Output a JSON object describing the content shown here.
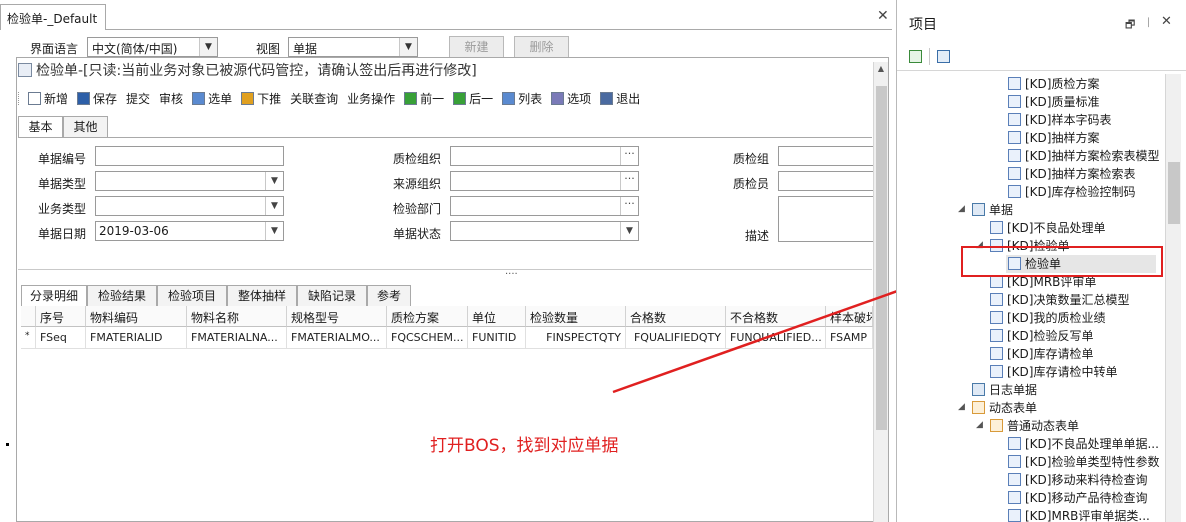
{
  "left_window": {
    "tab_title": "检验单-_Default",
    "top_row": {
      "ui_language_label": "界面语言",
      "ui_language_value": "中文(简体/中国)",
      "view_label": "视图",
      "view_value": "单据",
      "new_button": "新建",
      "delete_button": "删除"
    },
    "title": "检验单-[只读:当前业务对象已被源代码管控，请确认签出后再进行修改]",
    "toolbar": [
      {
        "label": "新增",
        "icon": "new-doc-icon"
      },
      {
        "label": "保存",
        "icon": "save-icon"
      },
      {
        "label": "提交",
        "icon": ""
      },
      {
        "label": "审核",
        "icon": ""
      },
      {
        "label": "选单",
        "icon": "select-bill-icon"
      },
      {
        "label": "下推",
        "icon": "push-down-icon"
      },
      {
        "label": "关联查询",
        "icon": ""
      },
      {
        "label": "业务操作",
        "icon": ""
      },
      {
        "label": "前一",
        "icon": "prev-arrow-icon"
      },
      {
        "label": "后一",
        "icon": "next-arrow-icon"
      },
      {
        "label": "列表",
        "icon": "list-icon"
      },
      {
        "label": "选项",
        "icon": "options-icon"
      },
      {
        "label": "退出",
        "icon": "exit-icon"
      }
    ],
    "header_tabs": [
      "基本",
      "其他"
    ],
    "form": {
      "bill_no_label": "单据编号",
      "bill_type_label": "单据类型",
      "biz_type_label": "业务类型",
      "bill_date_label": "单据日期",
      "bill_date_value": "2019-03-06",
      "qc_org_label": "质检组织",
      "source_org_label": "来源组织",
      "inspect_dept_label": "检验部门",
      "bill_status_label": "单据状态",
      "qc_group_label": "质检组",
      "qc_person_label": "质检员",
      "desc_label": "描述"
    },
    "splitter_dots": "....",
    "detail_tabs": [
      "分录明细",
      "检验结果",
      "检验项目",
      "整体抽样",
      "缺陷记录",
      "参考"
    ],
    "grid": {
      "columns": [
        "序号",
        "物料编码",
        "物料名称",
        "规格型号",
        "质检方案",
        "单位",
        "检验数量",
        "合格数",
        "不合格数",
        "样本破坏"
      ],
      "row_marker": "*",
      "row": [
        "FSeq",
        "FMATERIALID",
        "FMATERIALNA...",
        "FMATERIALMO...",
        "FQCSCHEM...",
        "FUNITID",
        "FINSPECTQTY",
        "FQUALIFIEDQTY",
        "FUNQUALIFIED...",
        "FSAMP"
      ]
    },
    "annotation": "打开BOS，找到对应单据"
  },
  "right_panel": {
    "title": "项目",
    "tree": [
      {
        "label": "[KD]质检方案",
        "indent": 3,
        "icon": "form-icon"
      },
      {
        "label": "[KD]质量标准",
        "indent": 3,
        "icon": "form-icon"
      },
      {
        "label": "[KD]样本字码表",
        "indent": 3,
        "icon": "form-icon"
      },
      {
        "label": "[KD]抽样方案",
        "indent": 3,
        "icon": "form-icon"
      },
      {
        "label": "[KD]抽样方案检索表模型",
        "indent": 3,
        "icon": "form-icon"
      },
      {
        "label": "[KD]抽样方案检索表",
        "indent": 3,
        "icon": "form-icon"
      },
      {
        "label": "[KD]库存检验控制码",
        "indent": 3,
        "icon": "form-icon"
      },
      {
        "label": "单据",
        "indent": 1,
        "icon": "folder-icon",
        "expander": "◢"
      },
      {
        "label": "[KD]不良品处理单",
        "indent": 2,
        "icon": "form-icon"
      },
      {
        "label": "[KD]检验单",
        "indent": 2,
        "icon": "form-icon",
        "expander": "◢"
      },
      {
        "label": "检验单",
        "indent": 3,
        "icon": "form-icon",
        "highlighted": true
      },
      {
        "label": "[KD]MRB评审单",
        "indent": 2,
        "icon": "form-icon"
      },
      {
        "label": "[KD]决策数量汇总模型",
        "indent": 2,
        "icon": "form-icon"
      },
      {
        "label": "[KD]我的质检业绩",
        "indent": 2,
        "icon": "form-icon"
      },
      {
        "label": "[KD]检验反写单",
        "indent": 2,
        "icon": "form-icon"
      },
      {
        "label": "[KD]库存请检单",
        "indent": 2,
        "icon": "form-icon"
      },
      {
        "label": "[KD]库存请检中转单",
        "indent": 2,
        "icon": "form-icon"
      },
      {
        "label": "日志单据",
        "indent": 1,
        "icon": "folder-icon"
      },
      {
        "label": "动态表单",
        "indent": 1,
        "icon": "dynamic-form-icon",
        "expander": "◢"
      },
      {
        "label": "普通动态表单",
        "indent": 2,
        "icon": "dynamic-form-icon",
        "expander": "◢"
      },
      {
        "label": "[KD]不良品处理单单据...",
        "indent": 3,
        "icon": "form-icon"
      },
      {
        "label": "[KD]检验单类型特性参数",
        "indent": 3,
        "icon": "form-icon"
      },
      {
        "label": "[KD]移动来料待检查询",
        "indent": 3,
        "icon": "form-icon"
      },
      {
        "label": "[KD]移动产品待检查询",
        "indent": 3,
        "icon": "form-icon"
      },
      {
        "label": "[KD]MRB评审单据类...",
        "indent": 3,
        "icon": "form-icon"
      }
    ]
  },
  "colors": {
    "annotation_red": "#e02020",
    "highlight_box": "#e02020",
    "tree_selected_bg": "#e6e6e6"
  }
}
